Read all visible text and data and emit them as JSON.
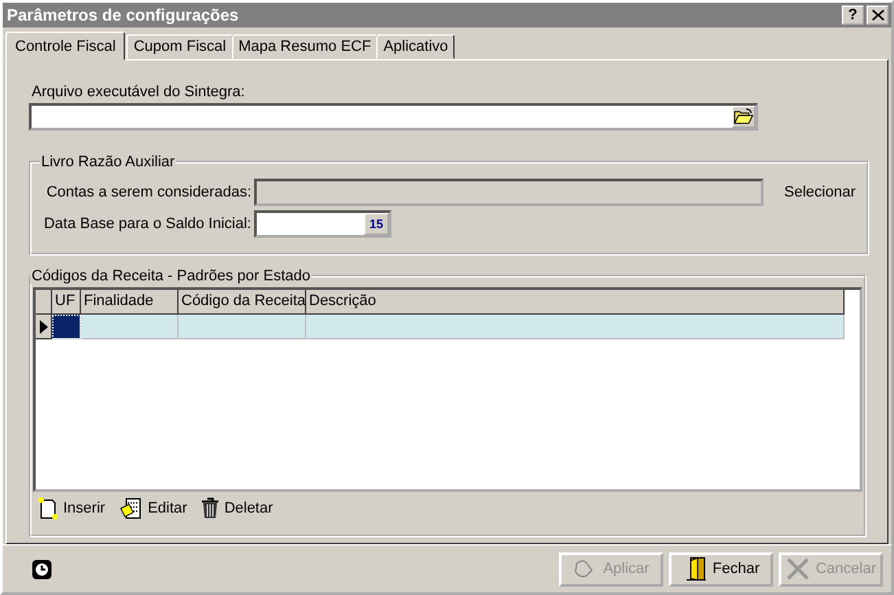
{
  "window": {
    "title": "Parâmetros de configurações",
    "help_button": "?"
  },
  "tabs": [
    {
      "label": "Controle Fiscal",
      "selected": true
    },
    {
      "label": "Cupom Fiscal",
      "selected": false
    },
    {
      "label": "Mapa Resumo ECF",
      "selected": false
    },
    {
      "label": "Aplicativo",
      "selected": false
    }
  ],
  "sintegra": {
    "label": "Arquivo executável do Sintegra:"
  },
  "livro": {
    "title": "Livro Razão Auxiliar",
    "contas_label": "Contas a serem consideradas:",
    "contas_disabled": true,
    "selecionar": "Selecionar",
    "data_label": "Data Base para o Saldo Inicial:",
    "calendar_day": "15"
  },
  "codigos": {
    "title": "Códigos da Receita - Padrões por Estado",
    "table": {
      "columns": [
        "UF",
        "Finalidade",
        "Código da Receita",
        "Descrição"
      ],
      "rows": [
        {
          "selected": true
        }
      ]
    },
    "toolbar": [
      {
        "kind": "insert",
        "label": "Inserir"
      },
      {
        "kind": "edit",
        "label": "Editar"
      },
      {
        "kind": "delete",
        "label": "Deletar"
      }
    ]
  },
  "buttons": [
    {
      "kind": "apply",
      "label": "Aplicar",
      "disabled": true
    },
    {
      "kind": "close",
      "label": "Fechar",
      "disabled": false
    },
    {
      "kind": "cancel",
      "label": "Cancelar",
      "disabled": true
    }
  ]
}
